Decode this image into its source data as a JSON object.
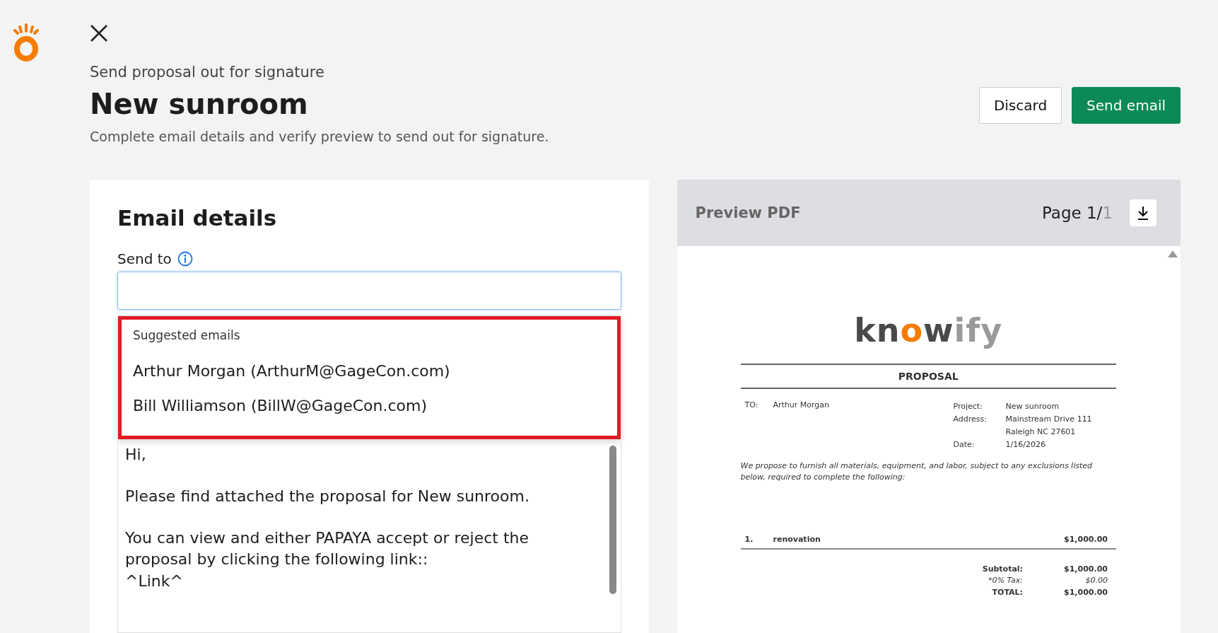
{
  "header": {
    "subtitle": "Send proposal out for signature",
    "title": "New sunroom",
    "description": "Complete email details and verify preview to send out for signature."
  },
  "actions": [
    {
      "label": "Discard",
      "kind": "secondary"
    },
    {
      "label": "Send email",
      "kind": "primary"
    }
  ],
  "email_details": {
    "heading": "Email details",
    "send_to_label": "Send to",
    "suggestions": {
      "heading": "Suggested emails",
      "highlighted": true,
      "items": [
        "Arthur Morgan (ArthurM@GageCon.com)",
        "Bill Williamson (BillW@GageCon.com)"
      ]
    },
    "message": [
      "Hi,",
      "Please find attached the proposal for New sunroom.",
      "You can view and either PAPAYA accept or reject the proposal by clicking the following link::\n^Link^"
    ]
  },
  "preview": {
    "title": "Preview PDF",
    "page_label": "Page 1/",
    "page_total": "1",
    "document": {
      "logo": [
        {
          "text": "kn",
          "kind": "dark"
        },
        {
          "text": "o",
          "kind": "accent"
        },
        {
          "text": "w",
          "kind": "dark"
        },
        {
          "text": "ify",
          "kind": "light"
        }
      ],
      "heading": "PROPOSAL",
      "to_label": "TO:",
      "to_value": "Arthur Morgan",
      "fields": [
        {
          "label": "Project:",
          "value": "New sunroom"
        },
        {
          "label": "Address:",
          "value": "Mainstream Drive 111"
        },
        {
          "value": "Raleigh NC 27601"
        },
        {
          "label": "Date:",
          "value": "1/16/2026"
        }
      ],
      "intro": "We propose to furnish all materials, equipment, and labor, subject to any exclusions listed below, required to complete the following:",
      "items": [
        {
          "number": "1.",
          "name": "renovation",
          "amount": "$1,000.00"
        }
      ],
      "totals": [
        {
          "label": "Subtotal:",
          "value": "$1,000.00",
          "italic": false
        },
        {
          "label": "*0% Tax:",
          "value": "$0.00",
          "italic": true
        },
        {
          "label": "TOTAL:",
          "value": "$1,000.00",
          "italic": false
        }
      ]
    }
  }
}
